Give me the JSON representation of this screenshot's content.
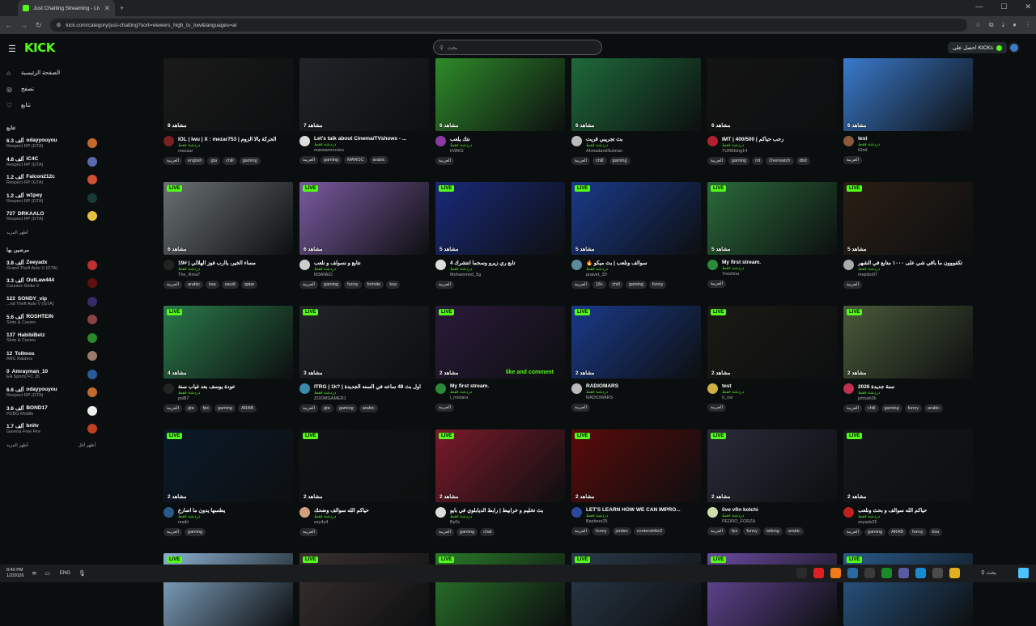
{
  "browser": {
    "tab_title": "Just Chatting Streaming - Live",
    "url": "kick.com/category/just-chatting?sort=viewers_high_to_low&languages=ar"
  },
  "header": {
    "logo": "KICK",
    "search_placeholder": "بحث",
    "get_kicks": "احصل على KICKs"
  },
  "sidebar": {
    "nav": [
      {
        "label": "الصفحة الرئيسية",
        "icon": "home-icon"
      },
      {
        "label": "تصفح",
        "icon": "browse-icon"
      },
      {
        "label": "تتابع",
        "icon": "heart-icon"
      }
    ],
    "following_title": "تتابع",
    "following": [
      {
        "name": "odayyouyou",
        "viewers": "6.3 ألف",
        "cat": "Respect RP (GTA)",
        "color": "#c46a2a"
      },
      {
        "name": "iC4C",
        "viewers": "4.8 ألف",
        "cat": "Respect RP (GTA)",
        "color": "#5a6ab0"
      },
      {
        "name": "Falcon212c",
        "viewers": "1.2 ألف",
        "cat": "Respect RP (GTA)",
        "color": "#d05030"
      },
      {
        "name": "w1pey",
        "viewers": "1.2 ألف",
        "cat": "Respect RP (GTA)",
        "color": "#1a3a3a"
      },
      {
        "name": "DRKAALO",
        "viewers": "727",
        "cat": "Respect RP (GTA)",
        "color": "#e6c040"
      }
    ],
    "show_more": "أظهر المزيد",
    "recommended_title": "مرصين بها",
    "recommended": [
      {
        "name": "Zeeyadx",
        "viewers": "3.8 ألف",
        "cat": "Grand Theft Auto V (GTA)",
        "color": "#c03030"
      },
      {
        "name": "OutLaw444",
        "viewers": "3.3 ألف",
        "cat": "Counter-Strike 2",
        "color": "#601010"
      },
      {
        "name": "SONDY_vip",
        "viewers": "122",
        "cat": "...nd Theft Auto V (GTA)",
        "color": "#3a2a6a"
      },
      {
        "name": "ROSHTEIN",
        "viewers": "5.6 ألف",
        "cat": "Slots & Casino",
        "color": "#884444"
      },
      {
        "name": "HabibiBetz",
        "viewers": "137",
        "cat": "Slots & Casino",
        "color": "#2a8a2a"
      },
      {
        "name": "Tollmos",
        "viewers": "12",
        "cat": "ARC Raiders",
        "color": "#9a7a6a"
      },
      {
        "name": "Amrayman_10",
        "viewers": "0",
        "cat": "EA Sports FC 26",
        "color": "#2a5a9a"
      },
      {
        "name": "odayyouyou",
        "viewers": "6.6 ألف",
        "cat": "Respect RP (GTA)",
        "color": "#c46a2a"
      },
      {
        "name": "BOND17",
        "viewers": "3.6 ألف",
        "cat": "PUBG Mobile",
        "color": "#eeeeee"
      },
      {
        "name": "bnitv",
        "viewers": "1.7 ألف",
        "cat": "Garena Free Fire",
        "color": "#c04020"
      }
    ],
    "show_more_2": "أظهر المزيد",
    "show_less": "أظهر أقل"
  },
  "grid": {
    "live_label": "LIVE",
    "category_label": "دردشة فقط",
    "rows": [
      [
        {
          "viewers": "8 مشاهد",
          "title": "IOL | Iwu | X : mezar753 | الحركة يالا الزوم",
          "channel": "mezaar",
          "tags": [
            "العربية",
            "english",
            "gta",
            "chill",
            "gaming"
          ],
          "thumb": "#1a1a1a",
          "av": "#7a2020"
        },
        {
          "viewers": "7 مشاهد",
          "title": "Let's talk about Cinema/TVshows - ...",
          "channel": "marwanmovies",
          "tags": [
            "العربية",
            "gaming",
            "MAROC",
            "arabic"
          ],
          "thumb": "#202428",
          "av": "#dddddd"
        },
        {
          "viewers": "6 مشاهد",
          "title": "نتك يلعب",
          "channel": "iiVAKS",
          "tags": [
            "العربية"
          ],
          "thumb": "#2f8a2a",
          "av": "#8a3aa0"
        },
        {
          "viewers": "6 مشاهد",
          "title": "بث تجريبي قريت",
          "channel": "AhmadandSulman",
          "tags": [
            "العربية",
            "chill",
            "gaming"
          ],
          "thumb": "#1e6a3a",
          "av": "#bbbbbb"
        },
        {
          "viewers": "6 مشاهد",
          "title": "IMT | 400/500 | رحب حياكم",
          "channel": "TURKking14",
          "tags": [
            "العربية",
            "gaming",
            "mt",
            "Overwatch",
            "dbd"
          ],
          "thumb": "#141414",
          "av": "#b02030"
        },
        {
          "viewers": "6 مشاهد",
          "title": "test",
          "channel": "iGnit",
          "tags": [
            "العربية"
          ],
          "thumb": "#3a7acc",
          "av": "#8a5a3a"
        }
      ],
      [
        {
          "viewers": "6 مشاهد",
          "title": "مساء الخير، ياارب فوز الهلالي | #19",
          "channel": "The_Rma7",
          "tags": [
            "العربية",
            "arabic",
            "ksa",
            "saudi",
            "qatar"
          ],
          "thumb": "#6a7070",
          "av": "#222222"
        },
        {
          "viewers": "6 مشاهد",
          "title": "نتابع و نسولف و نلعب",
          "channel": "M3ANED",
          "tags": [
            "العربية",
            "gaming",
            "funny",
            "fortnite",
            "ksa"
          ],
          "thumb": "#7a5aa0",
          "av": "#cccccc"
        },
        {
          "viewers": "5 مشاهد",
          "title": "تابع ري زيرو وسحما انتشرك 4",
          "channel": "Mohammed_5g",
          "tags": [
            "العربية"
          ],
          "thumb": "#1a2a7a",
          "av": "#dddddd"
        },
        {
          "viewers": "5 مشاهد",
          "title": "🔥 سوالف ونلعب | بث ميكو",
          "channel": "praivet_20",
          "tags": [
            "العربية",
            "18+",
            "chill",
            "gaming",
            "funny"
          ],
          "thumb": "#1a3a8a",
          "av": "#5a8aa0"
        },
        {
          "viewers": "5 مشاهد",
          "title": "My first stream.",
          "channel": "7ooshna",
          "tags": [
            "العربية"
          ],
          "thumb": "#2a6a3a",
          "av": "#2a8a3a"
        },
        {
          "viewers": "5 مشاهد",
          "title": "تكفووون ما باقي شي على ١٠٠٠ متابع في الشهر",
          "channel": "mejobo07",
          "tags": [
            "العربية"
          ],
          "thumb": "#2a1e14",
          "av": "#aaaaaa"
        }
      ],
      [
        {
          "viewers": "4 مشاهد",
          "title": "عودة يوسف بعد غياب سنة",
          "channel": "po8l7",
          "tags": [
            "العربية",
            "gta",
            "fps",
            "gaming",
            "ARAB"
          ],
          "thumb": "#2a7a4a",
          "av": "#222222"
        },
        {
          "viewers": "3 مشاهد",
          "title": "ITRG | 1k? | اول بث 48 ساعه في السنه الجديدة",
          "channel": "ZOOMGAMER1",
          "tags": [
            "العربية",
            "gta",
            "gaming",
            "arabic"
          ],
          "thumb": "#202428",
          "av": "#3a8aaa"
        },
        {
          "viewers": "2 مشاهد",
          "title": "My first stream.",
          "channel": "l_mistara",
          "tags": [
            "العربية"
          ],
          "thumb": "#2a1a3a",
          "av": "#2a8a3a"
        },
        {
          "viewers": "2 مشاهد",
          "title": "RADIOMARS",
          "channel": "RADIOMARS",
          "tags": [
            "العربية"
          ],
          "thumb": "#1a3a8a",
          "av": "#bbbbbb"
        },
        {
          "viewers": "2 مشاهد",
          "title": "test",
          "channel": "0_nsr",
          "tags": [
            "العربية"
          ],
          "thumb": "#1a1a14",
          "av": "#d0b040"
        },
        {
          "viewers": "2 مشاهد",
          "title": "سنة جديدة 2026",
          "channel": "johnah3k",
          "tags": [
            "العربية",
            "chill",
            "gaming",
            "funny",
            "arabic"
          ],
          "thumb": "#4a5a3a",
          "av": "#c03050"
        }
      ],
      [
        {
          "viewers": "2 مشاهد",
          "title": "يطسها يدون ما اصارع",
          "channel": "maikl",
          "tags": [
            "العربية",
            "gaming"
          ],
          "thumb": "#0a1a2a",
          "av": "#2a5a8a"
        },
        {
          "viewers": "2 مشاهد",
          "title": "حياكم الله سوالف وضحك",
          "channel": "ezy4y4",
          "tags": [
            "العربية"
          ],
          "thumb": "#101214",
          "av": "#d0a080"
        },
        {
          "viewers": "2 مشاهد",
          "title": "بث تخليم و خرابيط | رابط الديابلوي في بايو",
          "channel": "By0c",
          "tags": [
            "العربية",
            "gaming",
            "chat"
          ],
          "thumb": "#7a1a2a",
          "av": "#dddddd"
        },
        {
          "viewers": "2 مشاهد",
          "title": "LET'S LEARN HOW WE CAN IMPRO...",
          "channel": "Basheer25",
          "tags": [
            "العربية",
            "funny",
            "jordan",
            "conterstrike2"
          ],
          "thumb": "#5a0a0a",
          "av": "#2a4aa0"
        },
        {
          "viewers": "2 مشاهد",
          "title": "live vfin kolchi",
          "channel": "PEDRO_FORZA",
          "tags": [
            "العربية",
            "fps",
            "funny",
            "talking",
            "arabic"
          ],
          "thumb": "#2a2a3a",
          "av": "#ccddaa"
        },
        {
          "viewers": "2 مشاهد",
          "title": "حياكم الله سوالف و بحث ونلعب",
          "channel": "zeyadx25",
          "tags": [
            "العربية",
            "gaming",
            "ARAB",
            "funny",
            "ksa"
          ],
          "thumb": "#14181a",
          "av": "#c02020"
        }
      ],
      [
        {
          "viewers": "",
          "title": "",
          "channel": "",
          "tags": [],
          "thumb": "#8ab0d0",
          "av": "#333"
        },
        {
          "viewers": "",
          "title": "",
          "channel": "",
          "tags": [],
          "thumb": "#3a3030",
          "av": "#333"
        },
        {
          "viewers": "",
          "title": "",
          "channel": "",
          "tags": [],
          "thumb": "#2a7a2a",
          "av": "#333"
        },
        {
          "viewers": "",
          "title": "",
          "channel": "",
          "tags": [],
          "thumb": "#2a3a4a",
          "av": "#333"
        },
        {
          "viewers": "",
          "title": "",
          "channel": "",
          "tags": [],
          "thumb": "#6a4aa0",
          "av": "#333"
        },
        {
          "viewers": "",
          "title": "",
          "channel": "",
          "tags": [],
          "thumb": "#2a5a8a",
          "av": "#333"
        }
      ]
    ],
    "overlay": "like and comment"
  },
  "taskbar": {
    "time": "8:40 PM",
    "date": "1/2/2026",
    "lang": "ENG",
    "search": "بحث"
  }
}
